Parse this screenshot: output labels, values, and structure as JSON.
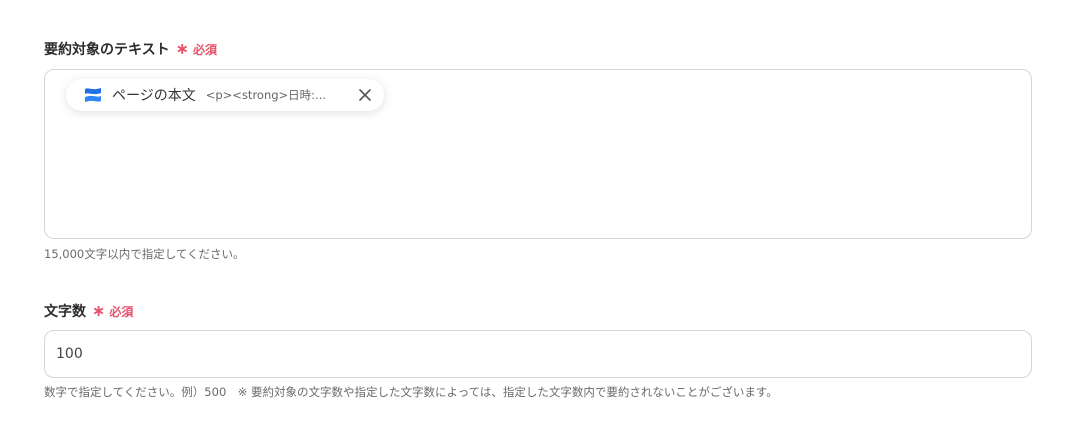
{
  "summary_field": {
    "label": "要約対象のテキスト",
    "required_star": "∗",
    "required_text": "必須",
    "chip": {
      "icon": "confluence-icon",
      "title": "ページの本文",
      "value": "<p><strong>日時:...",
      "close_icon": "close-icon"
    },
    "help": "15,000文字以内で指定してください。"
  },
  "char_count_field": {
    "label": "文字数",
    "required_star": "∗",
    "required_text": "必須",
    "value": "100",
    "help": "数字で指定してください。例）500　※ 要約対象の文字数や指定した文字数によっては、指定した文字数内で要約されないことがございます。"
  },
  "colors": {
    "required": "#e5546a",
    "border": "#d2d6dc",
    "icon_blue": "#1f6fe5"
  }
}
